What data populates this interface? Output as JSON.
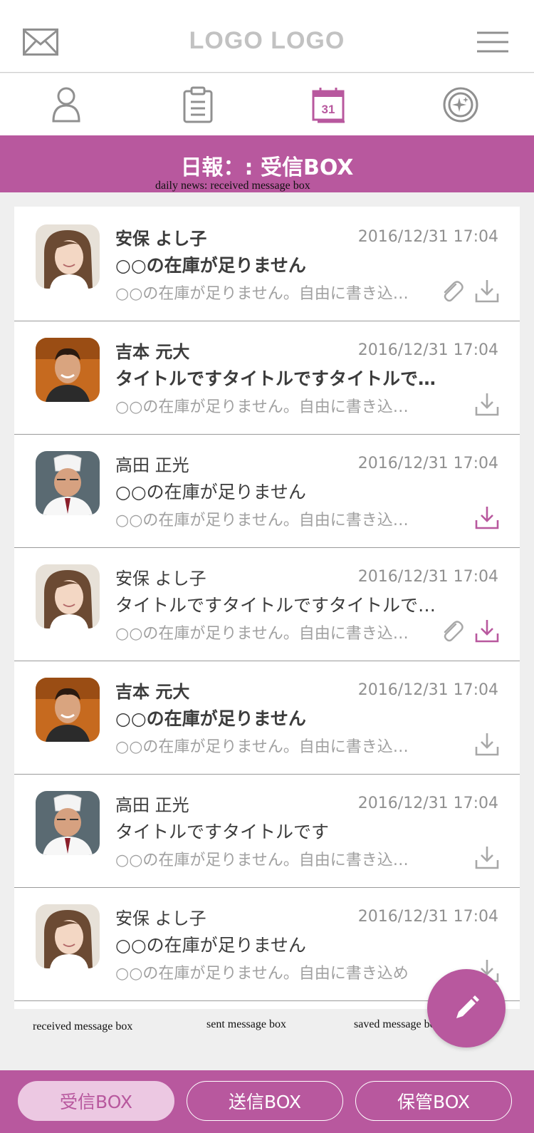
{
  "header": {
    "logo": "LOGO LOGO"
  },
  "nav": {
    "active_index": 2,
    "calendar_day": "31"
  },
  "banner": {
    "title": "日報：: 受信BOX",
    "annotation": "daily news: received message box"
  },
  "messages": [
    {
      "sender": "安保 よし子",
      "date": "2016/12/31 17:04",
      "subject": "○○の在庫が足りません",
      "preview": "○○の在庫が足りません。自由に書き込めます",
      "unread": true,
      "attachment": true,
      "downloaded": false,
      "avatar": "woman"
    },
    {
      "sender": "吉本 元大",
      "date": "2016/12/31 17:04",
      "subject": "タイトルですタイトルですタイトルですタイトルです",
      "preview": "○○の在庫が足りません。自由に書き込めます",
      "unread": true,
      "attachment": false,
      "downloaded": false,
      "avatar": "man"
    },
    {
      "sender": "高田 正光",
      "date": "2016/12/31 17:04",
      "subject": "○○の在庫が足りません",
      "preview": "○○の在庫が足りません。自由に書き込めます",
      "unread": false,
      "attachment": false,
      "downloaded": true,
      "avatar": "chef"
    },
    {
      "sender": "安保 よし子",
      "date": "2016/12/31 17:04",
      "subject": "タイトルですタイトルですタイトルですタイトルです",
      "preview": "○○の在庫が足りません。自由に書き込めます",
      "unread": false,
      "attachment": true,
      "downloaded": true,
      "avatar": "woman"
    },
    {
      "sender": "吉本 元大",
      "date": "2016/12/31 17:04",
      "subject": "○○の在庫が足りません",
      "preview": "○○の在庫が足りません。自由に書き込めます",
      "unread": true,
      "attachment": false,
      "downloaded": false,
      "avatar": "man"
    },
    {
      "sender": "高田 正光",
      "date": "2016/12/31 17:04",
      "subject": "タイトルですタイトルです",
      "preview": "○○の在庫が足りません。自由に書き込めます",
      "unread": false,
      "attachment": false,
      "downloaded": false,
      "avatar": "chef"
    },
    {
      "sender": "安保 よし子",
      "date": "2016/12/31 17:04",
      "subject": "○○の在庫が足りません",
      "preview": "○○の在庫が足りません。自由に書き込め",
      "unread": false,
      "attachment": false,
      "downloaded": false,
      "avatar": "woman"
    }
  ],
  "annotations": {
    "received": "received message box",
    "sent": "sent message box",
    "saved": "saved message box"
  },
  "footer": {
    "received_label": "受信BOX",
    "sent_label": "送信BOX",
    "saved_label": "保管BOX"
  },
  "colors": {
    "accent": "#b8589e",
    "accent_light": "#ecc8e2",
    "icon_gray": "#a8a8a8"
  }
}
